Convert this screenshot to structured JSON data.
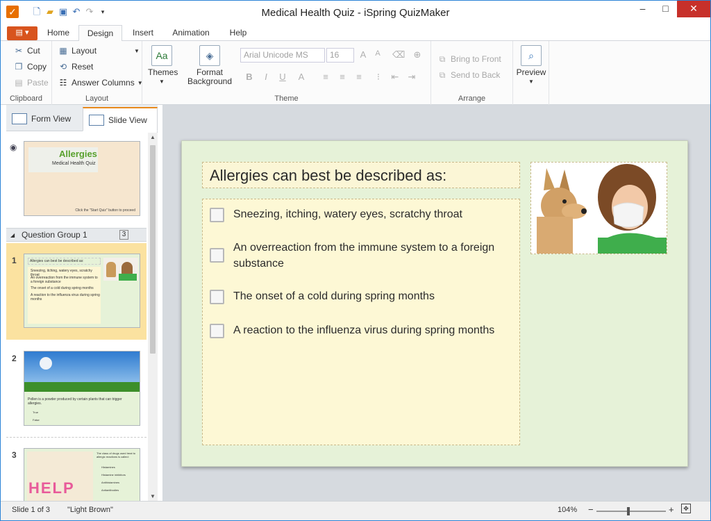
{
  "window": {
    "title": "Medical Health Quiz - iSpring QuizMaker",
    "minimize": "‒",
    "maximize": "□",
    "close": "✕"
  },
  "ribbon_tabs": [
    "Home",
    "Design",
    "Insert",
    "Animation",
    "Help"
  ],
  "clipboard": {
    "cut": "Cut",
    "copy": "Copy",
    "paste": "Paste",
    "label": "Clipboard"
  },
  "layout_group": {
    "layout": "Layout",
    "reset": "Reset",
    "answer_columns": "Answer Columns",
    "label": "Layout"
  },
  "theme_group": {
    "themes": "Themes",
    "format_background": "Format Background",
    "font": "Arial Unicode MS",
    "size": "16",
    "label": "Theme"
  },
  "arrange_group": {
    "bring_to_front": "Bring to Front",
    "send_to_back": "Send to Back",
    "label": "Arrange"
  },
  "preview": "Preview",
  "views": {
    "form": "Form View",
    "slide": "Slide View"
  },
  "thumbnails": {
    "slide0": {
      "title": "Allergies",
      "subtitle": "Medical Health Quiz",
      "footer": "Click the \"Start Quiz\" button to proceed"
    },
    "group": {
      "name": "Question Group 1",
      "count": "3"
    },
    "slide1": {
      "num": "1",
      "q": "Allergies can best be described as:",
      "a": [
        "Sneezing, itching, watery eyes, scratchy throat",
        "An overreaction from the immune system to a foreign substance",
        "The onset of a cold during spring months",
        "A reaction to the influenza virus during spring months"
      ]
    },
    "slide2": {
      "num": "2",
      "q": "Pollen is a powder produced by certain plants that can trigger allergies.",
      "a": [
        "True",
        "False"
      ]
    },
    "slide3": {
      "num": "3",
      "q": "The class of drugs used treat to allergic reactions is called:",
      "a": [
        "Histamines",
        "Histamine inhibitors",
        "Antihistamines",
        "Antiantibodies"
      ],
      "word": "HELP"
    }
  },
  "slide": {
    "question": "Allergies can best be described as:",
    "answers": [
      "Sneezing, itching, watery eyes, scratchy throat",
      "An overreaction from the immune system to a foreign substance",
      "The onset of a cold during spring months",
      "A reaction to the influenza virus during spring months"
    ]
  },
  "status": {
    "slide": "Slide 1 of 3",
    "theme": "\"Light Brown\"",
    "zoom": "104%"
  },
  "colors": {
    "accent": "#2b83d6",
    "file_tab": "#d8541e",
    "slide_bg": "#e6f2d8",
    "answer_bg": "#fdf8d5"
  }
}
